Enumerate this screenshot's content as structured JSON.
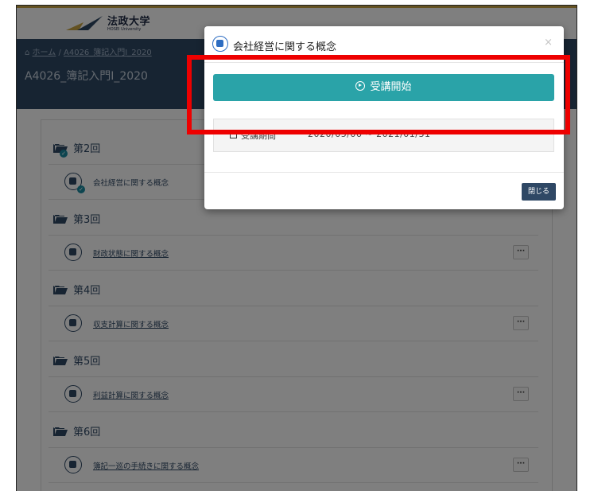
{
  "header": {
    "logo_main": "法政大学",
    "logo_sub": "HOSEI University",
    "colors": {
      "brand": "#2f4865",
      "accent": "#c9a544"
    }
  },
  "breadcrumb": {
    "home_label": "ホーム",
    "separator": "/",
    "course_label": "A4026_簿記入門Ⅰ_2020"
  },
  "course": {
    "title": "A4026_簿記入門Ⅰ_2020"
  },
  "sections": [
    {
      "label": "第2回",
      "activity": "会社経営に関する概念",
      "completed": true
    },
    {
      "label": "第3回",
      "activity": "財政状態に関する概念",
      "completed": false
    },
    {
      "label": "第4回",
      "activity": "収支計算に関する概念",
      "completed": false
    },
    {
      "label": "第5回",
      "activity": "利益計算に関する概念",
      "completed": false
    },
    {
      "label": "第6回",
      "activity": "簿記一巡の手続きに関する概念",
      "completed": false
    }
  ],
  "activity_menu_icon": "ellipsis-icon",
  "modal": {
    "title": "会社経営に関する概念",
    "close_symbol": "×",
    "start_button_label": "受講開始",
    "period_label": "受講期間",
    "period_value": "2020/05/06 ~ 2021/01/31",
    "close_button_label": "閉じる",
    "colors": {
      "button": "#2aa3a8",
      "icon": "#2d6dc2"
    }
  },
  "annotation": {
    "color": "#ee0000"
  }
}
